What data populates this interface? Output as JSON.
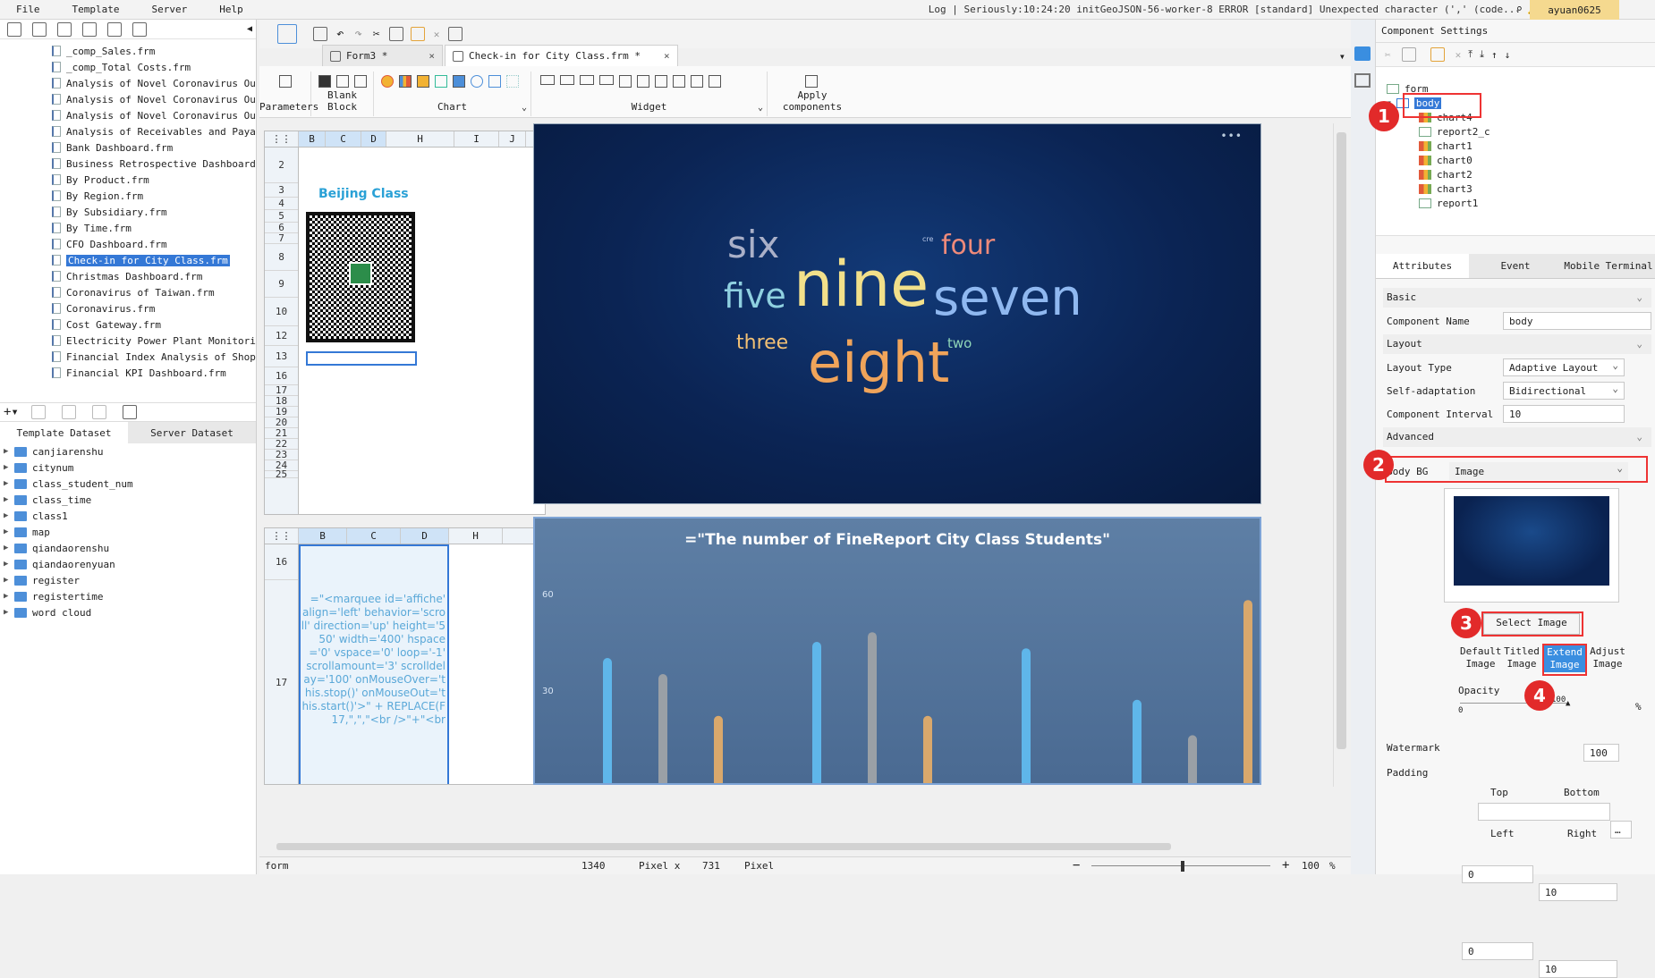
{
  "menu": [
    "File",
    "Template",
    "Server",
    "Help"
  ],
  "log_text": "Log | Seriously:10:24:20 initGeoJSON-56-worker-8 ERROR [standard] Unexpected character (',' (code...",
  "user": "ayuan0625",
  "files": [
    "_comp_Sales.frm",
    "_comp_Total Costs.frm",
    "Analysis of Novel Coronavirus Outb",
    "Analysis of Novel Coronavirus Outb",
    "Analysis of Novel Coronavirus Outb",
    "Analysis of Receivables and Payab",
    "Bank Dashboard.frm",
    "Business Retrospective Dashboard.:",
    "By Product.frm",
    "By Region.frm",
    "By Subsidiary.frm",
    "By Time.frm",
    "CFO Dashboard.frm",
    "Check-in for City Class.frm",
    "Christmas Dashboard.frm",
    "Coronavirus of Taiwan.frm",
    "Coronavirus.frm",
    "Cost Gateway.frm",
    "Electricity Power Plant Monitoring",
    "Financial Index Analysis of Shopp",
    "Financial KPI Dashboard.frm"
  ],
  "selected_file_index": 13,
  "dataset_tabs": [
    "Template Dataset",
    "Server Dataset"
  ],
  "datasets": [
    "canjiarenshu",
    "citynum",
    "class_student_num",
    "class_time",
    "class1",
    "map",
    "qiandaorenshu",
    "qiandaorenyuan",
    "register",
    "registertime",
    "word cloud"
  ],
  "tabs": [
    {
      "label": "Form3 *",
      "close": "×"
    },
    {
      "label": "Check-in for City Class.frm *",
      "close": "×"
    }
  ],
  "ribbon": {
    "params": "Parameters",
    "blank": "Blank Block",
    "chart": "Chart",
    "widget": "Widget",
    "apply": "Apply components"
  },
  "grid1": {
    "cols": [
      "B",
      "C",
      "D",
      "H",
      "I",
      "J"
    ],
    "rows": [
      "2",
      "3",
      "4",
      "5",
      "6",
      "7",
      "8",
      "9",
      "10",
      "12",
      "13",
      "16",
      "17",
      "18",
      "19",
      "20",
      "21",
      "22",
      "23",
      "24",
      "25"
    ],
    "title": "Beijing Class"
  },
  "grid2": {
    "cols": [
      "B",
      "C",
      "D",
      "H"
    ],
    "rows": [
      "16",
      "17"
    ],
    "code": "=\"<marquee id='affiche' align='left' behavior='scroll' direction='up' height='550' width='400' hspace='0' vspace='0' loop='-1' scrollamount='3' scrolldelay='100' onMouseOver='this.stop()' onMouseOut='this.start()'>\" + REPLACE(F17,\",\",\"<br />\"+\"<br"
  },
  "wordcloud": {
    "more": "•••",
    "words": [
      {
        "text": "six",
        "color": "#aab0c8",
        "size": 42
      },
      {
        "text": "four",
        "color": "#ee8a7a",
        "size": 30
      },
      {
        "text": "five",
        "color": "#8fd0e0",
        "size": 38
      },
      {
        "text": "nine",
        "color": "#f2e08a",
        "size": 70
      },
      {
        "text": "seven",
        "color": "#8fb8f0",
        "size": 56
      },
      {
        "text": "three",
        "color": "#f2c074",
        "size": 22
      },
      {
        "text": "two",
        "color": "#8fd6b8",
        "size": 15
      },
      {
        "text": "eight",
        "color": "#f0a45a",
        "size": 62
      },
      {
        "text": "cre",
        "color": "#b8c8e8",
        "size": 8
      }
    ]
  },
  "chart_data": {
    "type": "bar",
    "title": "=\"The number of FineReport City Class Students\"",
    "yticks": [
      60,
      30
    ],
    "ylim": [
      0,
      75
    ],
    "values": [
      40,
      35,
      22,
      45,
      48,
      22,
      43,
      0,
      27,
      16,
      58
    ],
    "colors": [
      "#5fb6ea",
      "#9aa0a6",
      "#d9a86c",
      "#5fb6ea",
      "#9aa0a6",
      "#d9a86c",
      "#5fb6ea",
      "#9aa0a6",
      "#5fb6ea",
      "#9aa0a6",
      "#d9a86c"
    ]
  },
  "right": {
    "title": "Component Settings",
    "tree": [
      "form",
      "body",
      "chart4",
      "report2_c",
      "chart1",
      "chart0",
      "chart2",
      "chart3",
      "report1"
    ],
    "tabs": [
      "Attributes",
      "Event",
      "Mobile Terminal"
    ],
    "basic": "Basic",
    "component_name_label": "Component Name",
    "component_name": "body",
    "layout": "Layout",
    "layout_type_label": "Layout Type",
    "layout_type": "Adaptive Layout",
    "self_adapt_label": "Self-adaptation",
    "self_adapt": "Bidirectional",
    "interval_label": "Component Interval",
    "interval": "10",
    "advanced": "Advanced",
    "body_bg_label": "Body BG",
    "body_bg": "Image",
    "select_image": "Select Image",
    "image_opts": [
      "Default Image",
      "Titled Image",
      "Extend Image",
      "Adjust Image"
    ],
    "opacity_label": "Opacity",
    "opacity_min": "0",
    "opacity_max": "100",
    "opacity": "100",
    "percent": "%",
    "watermark_label": "Watermark",
    "padding_label": "Padding",
    "pad_top": "0",
    "pad_bottom": "10",
    "pad_left": "0",
    "pad_right": "10",
    "top": "Top",
    "bottom": "Bottom",
    "left": "Left",
    "right": "Right"
  },
  "badges": [
    "1",
    "2",
    "3",
    "4"
  ],
  "status": {
    "mode": "form",
    "x": "1340",
    "xlabel": "Pixel x",
    "y": "731",
    "ylabel": "Pixel",
    "zoom": "100",
    "pct": "%"
  }
}
